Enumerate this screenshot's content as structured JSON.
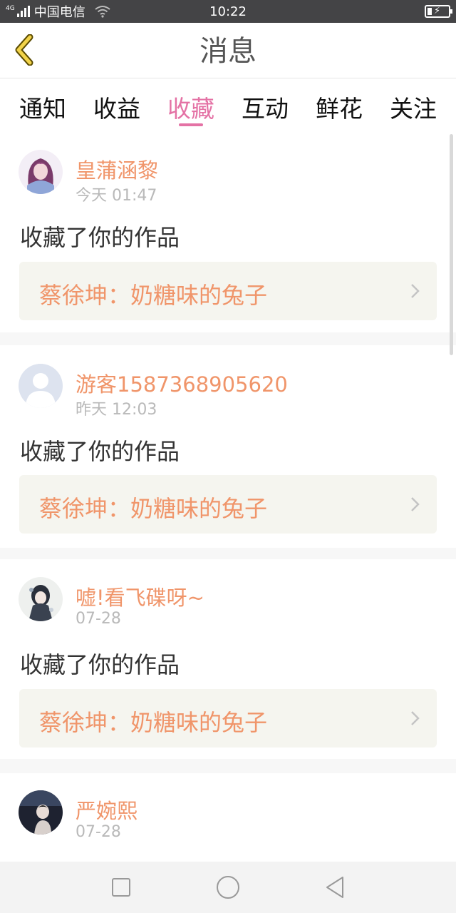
{
  "status_bar": {
    "network_type": "4G",
    "carrier": "中国电信",
    "time": "10:22",
    "icons": [
      "signal-icon",
      "wifi-icon",
      "battery-charging-icon"
    ]
  },
  "header": {
    "title": "消息",
    "back_icon": "chevron-left-icon"
  },
  "tabs": [
    {
      "label": "通知",
      "active": false
    },
    {
      "label": "收益",
      "active": false
    },
    {
      "label": "收藏",
      "active": true
    },
    {
      "label": "互动",
      "active": false
    },
    {
      "label": "鲜花",
      "active": false
    },
    {
      "label": "关注",
      "active": false
    }
  ],
  "messages": [
    {
      "user": "皇蒲涵黎",
      "time": "今天 01:47",
      "action": "收藏了你的作品",
      "work": "蔡徐坤：奶糖味的兔子"
    },
    {
      "user": "游客1587368905620",
      "time": "昨天 12:03",
      "action": "收藏了你的作品",
      "work": "蔡徐坤：奶糖味的兔子"
    },
    {
      "user": "嘘!看飞碟呀~",
      "time": "07-28",
      "action": "收藏了你的作品",
      "work": "蔡徐坤：奶糖味的兔子"
    },
    {
      "user": "严婉熙",
      "time": "07-28"
    }
  ],
  "nav_bar": {
    "icons": [
      "recent-apps-icon",
      "home-icon",
      "back-icon"
    ]
  },
  "colors": {
    "accent": "#e472a5",
    "username": "#f0956a",
    "status_bar": "#444446"
  }
}
